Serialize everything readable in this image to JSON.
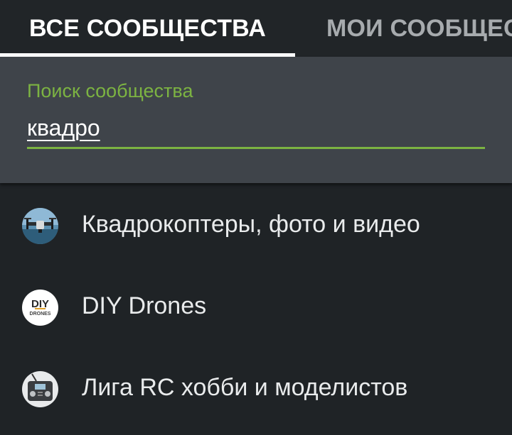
{
  "tabs": {
    "all_label": "ВСЕ СООБЩЕСТВА",
    "mine_label": "МОИ СООБЩЕСТВА",
    "active": "all"
  },
  "search": {
    "label": "Поиск сообщества",
    "value": "квадро"
  },
  "results": [
    {
      "label": "Квадрокоптеры, фото и видео",
      "icon": "drone-photo-avatar-icon"
    },
    {
      "label": "DIY Drones",
      "icon": "diy-drones-logo-icon",
      "logo_text": [
        "DIY",
        "DRONES"
      ]
    },
    {
      "label": "Лига RC хобби и моделистов",
      "icon": "rc-transmitter-avatar-icon"
    }
  ],
  "colors": {
    "background": "#1f2326",
    "search_panel": "#3f444a",
    "accent": "#7cb342",
    "tab_active": "#ffffff",
    "tab_inactive": "#a7abae"
  }
}
